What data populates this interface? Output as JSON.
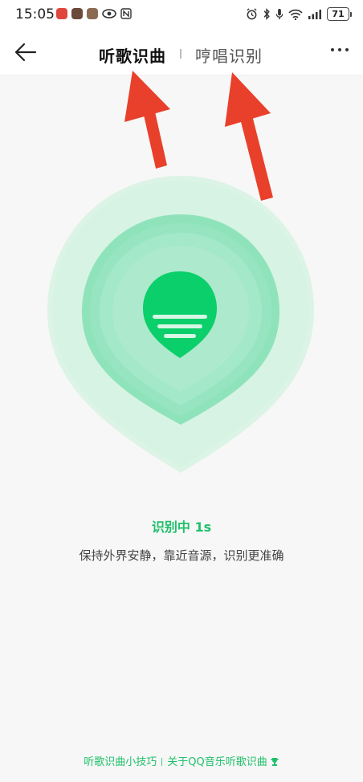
{
  "status_bar": {
    "time": "15:05",
    "battery": "71"
  },
  "header": {
    "tab_listen": "听歌识曲",
    "tab_hum": "哼唱识别"
  },
  "main": {
    "status_text": "识别中 1s",
    "hint_text": "保持外界安静，靠近音源，识别更准确"
  },
  "footer": {
    "tips_link": "听歌识曲小技巧",
    "about_link": "关于QQ音乐听歌识曲"
  },
  "colors": {
    "accent": "#1fc06a",
    "pin_core": "#0bcf6a",
    "arrow": "#e8402a"
  },
  "icons": [
    "back-arrow-icon",
    "more-icon",
    "music-pin-icon",
    "trophy-icon",
    "wifi-icon",
    "signal-icon",
    "battery-icon",
    "alarm-icon",
    "bluetooth-icon",
    "mic-icon"
  ]
}
